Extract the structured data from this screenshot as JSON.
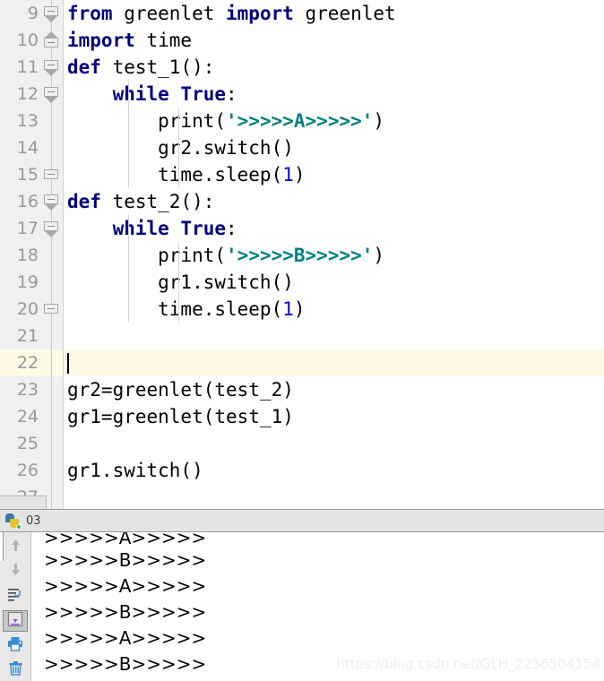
{
  "editor": {
    "caret_line_index": 13,
    "colors": {
      "keyword": "#000080",
      "string": "#008080",
      "number": "#0000ff",
      "plain": "#000000",
      "caret_line_bg": "#fffae6",
      "gutter_bg": "#f0f0f0"
    },
    "lines": [
      {
        "number": "9",
        "fold": "down",
        "indent": 0,
        "guides": 0,
        "tokens": [
          {
            "t": "from",
            "c": "kw"
          },
          {
            "t": " greenlet ",
            "c": "pln"
          },
          {
            "t": "import",
            "c": "kw"
          },
          {
            "t": " greenlet",
            "c": "pln"
          }
        ]
      },
      {
        "number": "10",
        "fold": "up",
        "indent": 0,
        "guides": 0,
        "tokens": [
          {
            "t": "import",
            "c": "kw"
          },
          {
            "t": " time",
            "c": "pln"
          }
        ]
      },
      {
        "number": "11",
        "fold": "down",
        "indent": 0,
        "guides": 0,
        "tokens": [
          {
            "t": "def",
            "c": "kw"
          },
          {
            "t": " test_1():",
            "c": "pln"
          }
        ]
      },
      {
        "number": "12",
        "fold": "down",
        "indent": 1,
        "guides": 1,
        "tokens": [
          {
            "t": "    ",
            "c": "pln"
          },
          {
            "t": "while",
            "c": "kw"
          },
          {
            "t": " ",
            "c": "pln"
          },
          {
            "t": "True",
            "c": "kw"
          },
          {
            "t": ":",
            "c": "pln"
          }
        ]
      },
      {
        "number": "13",
        "fold": "none",
        "indent": 2,
        "guides": 2,
        "tokens": [
          {
            "t": "        ",
            "c": "pln"
          },
          {
            "t": "print",
            "c": "pln"
          },
          {
            "t": "(",
            "c": "pln"
          },
          {
            "t": "'>>>>>A>>>>>'",
            "c": "str"
          },
          {
            "t": ")",
            "c": "pln"
          }
        ]
      },
      {
        "number": "14",
        "fold": "none",
        "indent": 2,
        "guides": 2,
        "tokens": [
          {
            "t": "        gr2.switch()",
            "c": "pln"
          }
        ]
      },
      {
        "number": "15",
        "fold": "plain",
        "indent": 2,
        "guides": 2,
        "tokens": [
          {
            "t": "        time.sleep(",
            "c": "pln"
          },
          {
            "t": "1",
            "c": "num"
          },
          {
            "t": ")",
            "c": "pln"
          }
        ]
      },
      {
        "number": "16",
        "fold": "down",
        "indent": 0,
        "guides": 0,
        "tokens": [
          {
            "t": "def",
            "c": "kw"
          },
          {
            "t": " test_2():",
            "c": "pln"
          }
        ]
      },
      {
        "number": "17",
        "fold": "down",
        "indent": 1,
        "guides": 1,
        "tokens": [
          {
            "t": "    ",
            "c": "pln"
          },
          {
            "t": "while",
            "c": "kw"
          },
          {
            "t": " ",
            "c": "pln"
          },
          {
            "t": "True",
            "c": "kw"
          },
          {
            "t": ":",
            "c": "pln"
          }
        ]
      },
      {
        "number": "18",
        "fold": "none",
        "indent": 2,
        "guides": 2,
        "tokens": [
          {
            "t": "        ",
            "c": "pln"
          },
          {
            "t": "print",
            "c": "pln"
          },
          {
            "t": "(",
            "c": "pln"
          },
          {
            "t": "'>>>>>B>>>>>'",
            "c": "str"
          },
          {
            "t": ")",
            "c": "pln"
          }
        ]
      },
      {
        "number": "19",
        "fold": "none",
        "indent": 2,
        "guides": 2,
        "tokens": [
          {
            "t": "        gr1.switch()",
            "c": "pln"
          }
        ]
      },
      {
        "number": "20",
        "fold": "plain",
        "indent": 2,
        "guides": 2,
        "tokens": [
          {
            "t": "        time.sleep(",
            "c": "pln"
          },
          {
            "t": "1",
            "c": "num"
          },
          {
            "t": ")",
            "c": "pln"
          }
        ]
      },
      {
        "number": "21",
        "fold": "none",
        "indent": 0,
        "guides": 0,
        "tokens": []
      },
      {
        "number": "22",
        "fold": "none",
        "indent": 0,
        "guides": 0,
        "tokens": [],
        "caret": true
      },
      {
        "number": "23",
        "fold": "none",
        "indent": 0,
        "guides": 0,
        "tokens": [
          {
            "t": "gr2=greenlet(test_2)",
            "c": "pln"
          }
        ]
      },
      {
        "number": "24",
        "fold": "none",
        "indent": 0,
        "guides": 0,
        "tokens": [
          {
            "t": "gr1=greenlet(test_1)",
            "c": "pln"
          }
        ]
      },
      {
        "number": "25",
        "fold": "none",
        "indent": 0,
        "guides": 0,
        "tokens": []
      },
      {
        "number": "26",
        "fold": "none",
        "indent": 0,
        "guides": 0,
        "tokens": [
          {
            "t": "gr1.switch()",
            "c": "pln"
          }
        ]
      },
      {
        "number": "27",
        "fold": "none",
        "indent": 0,
        "guides": 0,
        "tokens": []
      }
    ]
  },
  "console": {
    "tab": {
      "label": "03",
      "icon": "python-icon"
    },
    "toolbar": [
      {
        "name": "scroll-up-button",
        "icon": "arrow-up-icon",
        "active": false
      },
      {
        "name": "scroll-down-button",
        "icon": "arrow-down-icon",
        "active": false
      },
      {
        "name": "soft-wrap-button",
        "icon": "soft-wrap-icon",
        "active": false
      },
      {
        "name": "scroll-to-end-button",
        "icon": "scroll-to-end-icon",
        "active": true
      },
      {
        "name": "print-button",
        "icon": "printer-icon",
        "active": false
      },
      {
        "name": "clear-all-button",
        "icon": "trash-icon",
        "active": false
      }
    ],
    "output_lines": [
      ">>>>>A>>>>>",
      ">>>>>B>>>>>",
      ">>>>>A>>>>>",
      ">>>>>B>>>>>",
      ">>>>>A>>>>>",
      ">>>>>B>>>>>"
    ]
  },
  "watermark": {
    "text": "https://blog.csdn.net/GLH_2236504154"
  }
}
